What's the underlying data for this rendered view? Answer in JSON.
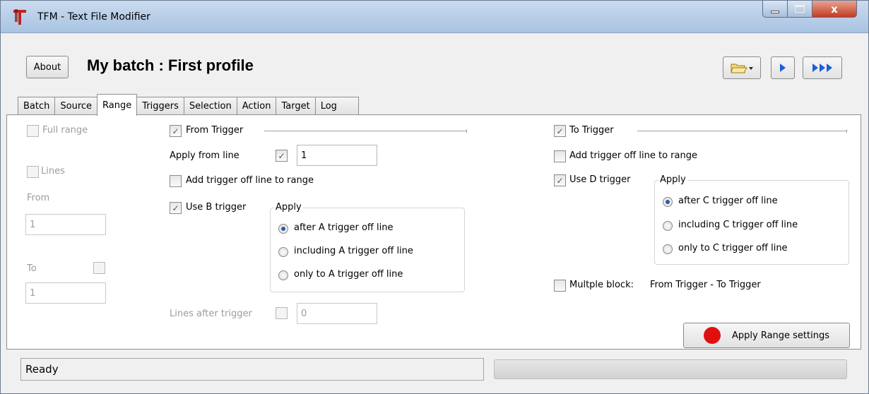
{
  "window": {
    "title": "TFM - Text File Modifier",
    "close_label": "x"
  },
  "header": {
    "about_label": "About",
    "batch_title": "My batch : First profile",
    "open_icon": "folder-open-icon",
    "run_icon": "play-icon",
    "run_all_icon": "play-all-icon"
  },
  "tabs": [
    {
      "label": "Batch"
    },
    {
      "label": "Source"
    },
    {
      "label": "Range",
      "active": true
    },
    {
      "label": "Triggers"
    },
    {
      "label": "Selection"
    },
    {
      "label": "Action"
    },
    {
      "label": "Target"
    },
    {
      "label": "Log"
    }
  ],
  "range": {
    "full_range_label": "Full range",
    "lines_label": "Lines",
    "from_label": "From",
    "from_value": "1",
    "to_label": "To",
    "to_value": "1",
    "from_trigger": {
      "label": "From Trigger",
      "checked": true,
      "apply_from_line_label": "Apply from line",
      "apply_from_line_value": "1",
      "add_off_line_label": "Add trigger off line to range",
      "use_b_label": "Use B trigger",
      "apply_group_title": "Apply",
      "options": [
        "after A trigger off line",
        "including A trigger off line",
        "only to A trigger off line"
      ],
      "selected_option": 0
    },
    "lines_after_trigger_label": "Lines after trigger",
    "lines_after_trigger_value": "0",
    "to_trigger": {
      "label": "To Trigger",
      "checked": true,
      "add_off_line_label": "Add trigger off line to range",
      "use_d_label": "Use D trigger",
      "apply_group_title": "Apply",
      "options": [
        "after C trigger off line",
        "including C trigger off line",
        "only to C trigger off line"
      ],
      "selected_option": 0
    },
    "multiple_block_label": "Multple block:",
    "multiple_block_value": "From Trigger - To Trigger",
    "apply_button_label": "Apply Range settings"
  },
  "status": {
    "text": "Ready",
    "progress": 0.0
  },
  "colors": {
    "accent": "#2a5ba8",
    "apply_dot": "#e01010",
    "title_bar": "#c9dbef"
  }
}
